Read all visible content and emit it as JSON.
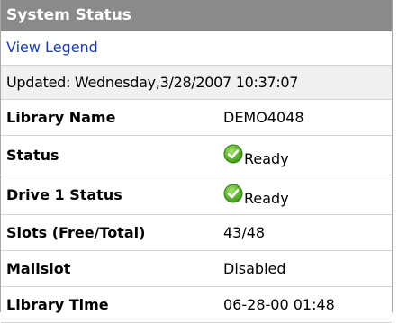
{
  "header": {
    "title": "System Status"
  },
  "legend_link": {
    "label": "View Legend"
  },
  "updated": {
    "text": "Updated: Wednesday,3/28/2007 10:37:07"
  },
  "rows": {
    "library_name": {
      "label": "Library Name",
      "value": "DEMO4048"
    },
    "status": {
      "label": "Status",
      "value": "Ready",
      "icon": "green-check-icon"
    },
    "drive1_status": {
      "label": "Drive 1 Status",
      "value": "Ready",
      "icon": "green-check-icon"
    },
    "slots": {
      "label": "Slots (Free/Total)",
      "value": "43/48"
    },
    "mailslot": {
      "label": "Mailslot",
      "value": "Disabled"
    },
    "library_time": {
      "label": "Library Time",
      "value": "06-28-00 01:48"
    }
  },
  "colors": {
    "header_bg": "#8a8a8a",
    "header_text": "#ffffff",
    "link": "#1a3fa6",
    "check_green": "#4caf1f"
  }
}
